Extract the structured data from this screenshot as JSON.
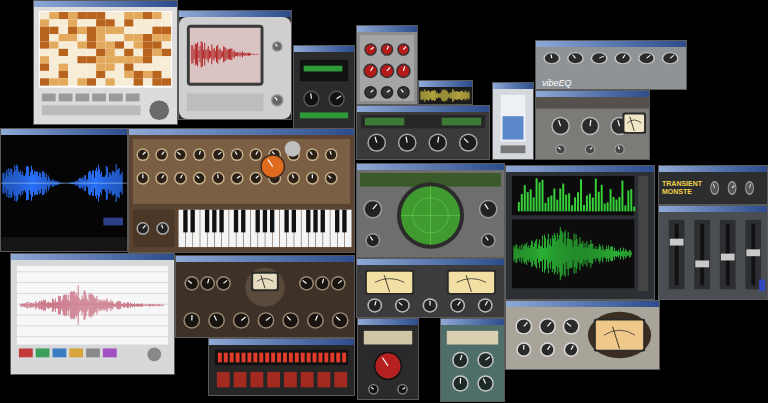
{
  "windows": [
    {
      "kind": "spectrogram"
    },
    {
      "kind": "monitor"
    },
    {
      "kind": "dyn"
    },
    {
      "kind": "knobs-red"
    },
    {
      "kind": "mini-wave"
    },
    {
      "kind": "meter-blue"
    },
    {
      "kind": "vibeeq",
      "label": "vibeEQ"
    },
    {
      "kind": "vu-comp"
    },
    {
      "kind": "blue-wave"
    },
    {
      "kind": "synth"
    },
    {
      "kind": "gauges"
    },
    {
      "kind": "radar"
    },
    {
      "kind": "green-wave"
    },
    {
      "kind": "transient",
      "label": "TRANSIENT MONSTE"
    },
    {
      "kind": "faders"
    },
    {
      "kind": "white-wave"
    },
    {
      "kind": "brown-knobs"
    },
    {
      "kind": "red-meters"
    },
    {
      "kind": "vu-knobs"
    },
    {
      "kind": "red-knob"
    },
    {
      "kind": "teal"
    },
    {
      "kind": "tan-vu"
    }
  ]
}
